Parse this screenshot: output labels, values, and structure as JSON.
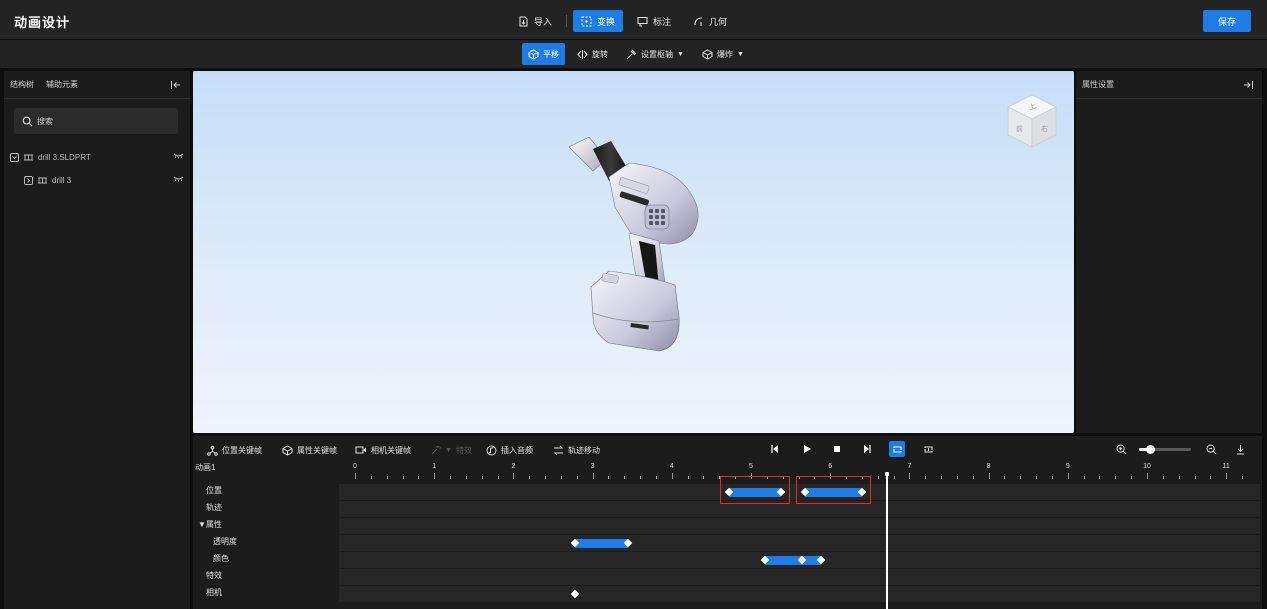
{
  "header": {
    "title": "动画设计",
    "tabs": [
      {
        "label": "导入",
        "icon": "import-icon",
        "active": false
      },
      {
        "label": "变换",
        "icon": "transform-icon",
        "active": true
      },
      {
        "label": "标注",
        "icon": "annotate-icon",
        "active": false
      },
      {
        "label": "几何",
        "icon": "geometry-icon",
        "active": false
      }
    ],
    "save_label": "保存"
  },
  "subtoolbar": {
    "tools": [
      {
        "label": "平移",
        "icon": "move-icon",
        "active": true
      },
      {
        "label": "旋转",
        "icon": "rotate-icon",
        "active": false
      },
      {
        "label": "设置枢轴",
        "icon": "pivot-icon",
        "dropdown": true
      },
      {
        "label": "爆炸",
        "icon": "explode-icon",
        "dropdown": true
      }
    ]
  },
  "left_panel": {
    "tabs": [
      "结构树",
      "辅助元素"
    ],
    "search_placeholder": "搜索",
    "tree": [
      {
        "label": "drill 3.SLDPRT",
        "expanded": true
      },
      {
        "label": "drill 3",
        "expanded": false
      }
    ]
  },
  "right_panel": {
    "title": "属性设置"
  },
  "timeline": {
    "toolbar": {
      "position_keyframe": "位置关键帧",
      "property_keyframe": "属性关键帧",
      "camera_keyframe": "相机关键帧",
      "effects": "特效",
      "insert_audio": "插入音频",
      "track_move": "轨迹移动"
    },
    "animation_name": "动画1",
    "tracks": [
      "位置",
      "轨迹",
      "▼属性",
      "透明度",
      "颜色",
      "特效",
      "相机"
    ],
    "ruler_labels": [
      "0",
      "1",
      "2",
      "3",
      "4",
      "5",
      "6",
      "7",
      "8",
      "9",
      "10",
      "11"
    ],
    "playhead_time": 6.7,
    "keyframe_bars": [
      {
        "track": 0,
        "start": 4.72,
        "end": 5.38,
        "selected": true
      },
      {
        "track": 0,
        "start": 5.68,
        "end": 6.4,
        "selected": true
      },
      {
        "track": 3,
        "start": 2.78,
        "end": 3.45,
        "selected": false
      },
      {
        "track": 4,
        "start": 5.18,
        "end": 5.88,
        "selected": false
      }
    ],
    "keyframe_points": [
      {
        "track": 4,
        "time": 5.65
      },
      {
        "track": 6,
        "time": 2.78
      }
    ]
  }
}
